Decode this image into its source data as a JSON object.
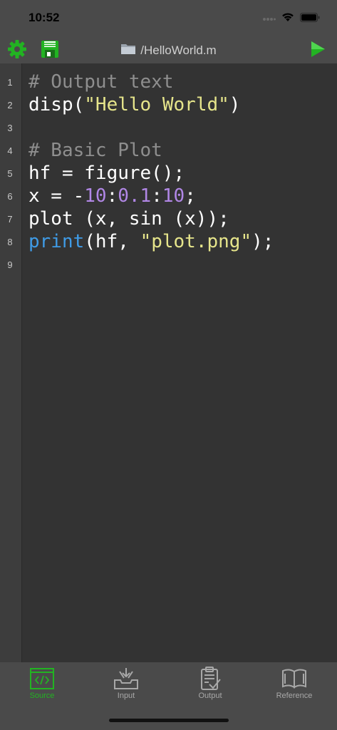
{
  "status_bar": {
    "time": "10:52"
  },
  "toolbar": {
    "title": "/HelloWorld.m",
    "settings_icon": "gear-icon",
    "save_icon": "floppy-disk-icon",
    "run_icon": "play-icon",
    "folder_icon": "folder-icon"
  },
  "editor": {
    "line_numbers": [
      "1",
      "2",
      "3",
      "4",
      "5",
      "6",
      "7",
      "8",
      "9"
    ],
    "lines": [
      {
        "segments": [
          {
            "text": "# Output text",
            "kind": "comment"
          }
        ]
      },
      {
        "segments": [
          {
            "text": "disp(",
            "kind": "plain"
          },
          {
            "text": "\"Hello World\"",
            "kind": "string"
          },
          {
            "text": ")",
            "kind": "plain"
          }
        ]
      },
      {
        "segments": []
      },
      {
        "segments": [
          {
            "text": "# Basic Plot",
            "kind": "comment"
          }
        ]
      },
      {
        "segments": [
          {
            "text": "hf = figure();",
            "kind": "plain"
          }
        ]
      },
      {
        "segments": [
          {
            "text": "x = -",
            "kind": "plain"
          },
          {
            "text": "10",
            "kind": "number"
          },
          {
            "text": ":",
            "kind": "plain"
          },
          {
            "text": "0.1",
            "kind": "number"
          },
          {
            "text": ":",
            "kind": "plain"
          },
          {
            "text": "10",
            "kind": "number"
          },
          {
            "text": ";",
            "kind": "plain"
          }
        ]
      },
      {
        "segments": [
          {
            "text": "plot (x, sin (x));",
            "kind": "plain"
          }
        ]
      },
      {
        "segments": [
          {
            "text": "print",
            "kind": "keyword"
          },
          {
            "text": "(hf, ",
            "kind": "plain"
          },
          {
            "text": "\"plot.png\"",
            "kind": "string"
          },
          {
            "text": ");",
            "kind": "plain"
          }
        ]
      },
      {
        "segments": []
      }
    ]
  },
  "tabs": [
    {
      "label": "Source",
      "icon": "code-icon",
      "active": true
    },
    {
      "label": "Input",
      "icon": "input-tray-icon",
      "active": false
    },
    {
      "label": "Output",
      "icon": "clipboard-check-icon",
      "active": false
    },
    {
      "label": "Reference",
      "icon": "book-icon",
      "active": false
    }
  ],
  "colors": {
    "accent_green": "#22b322",
    "inactive_tab": "#a8a8a8",
    "comment": "#8e8e8e",
    "string": "#e6e58b",
    "number": "#b187e6",
    "keyword": "#3f9be6"
  }
}
